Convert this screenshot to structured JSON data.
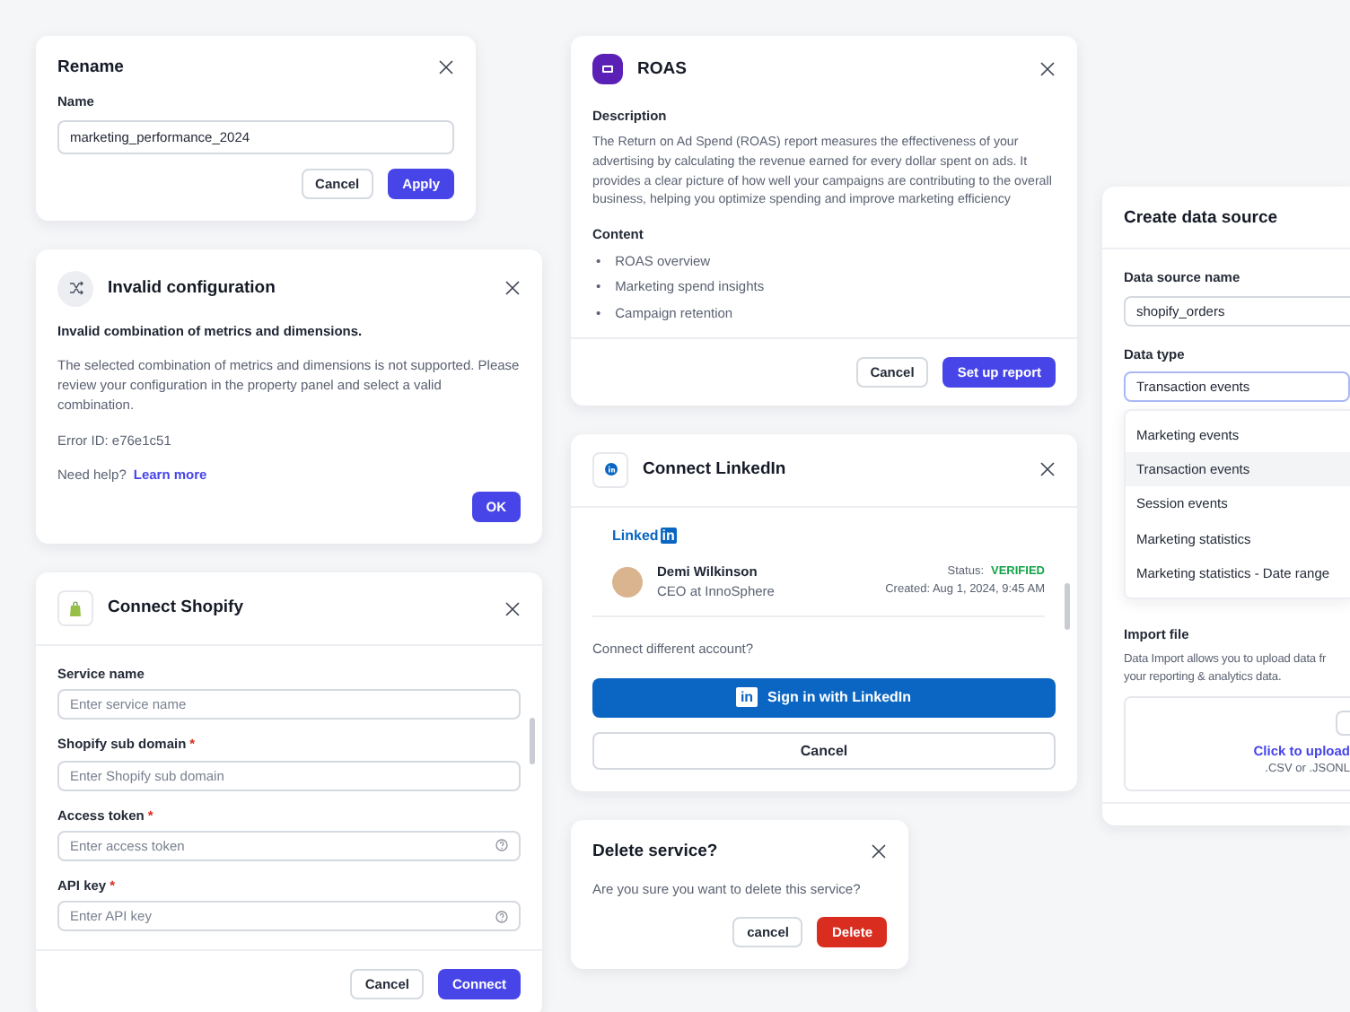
{
  "rename_dialog": {
    "title": "Rename",
    "field_label": "Name",
    "value": "marketing_performance_2024",
    "buttons": [
      {
        "label": "Cancel",
        "kind": "secondary"
      },
      {
        "label": "Apply",
        "kind": "primary"
      }
    ]
  },
  "error_dialog": {
    "title": "Invalid configuration",
    "heading": "Invalid combination of metrics and dimensions.",
    "message": "The selected combination of metrics and dimensions is not supported. Please review your configuration in the property panel and select a valid combination.",
    "error_id": "Error ID: e76e1c51",
    "help_text": "Need help?",
    "help_link": "Learn more",
    "buttons": [
      {
        "label": "OK",
        "kind": "primary"
      }
    ]
  },
  "shopify_dialog": {
    "title": "Connect Shopify",
    "fields": [
      {
        "label": "Service name",
        "placeholder": "Enter service name",
        "help_icon": false
      },
      {
        "label": "Shopify sub domain",
        "required_mark": "*",
        "placeholder": "Enter Shopify sub domain",
        "help_icon": false
      },
      {
        "label": "Access token",
        "required_mark": "*",
        "placeholder": "Enter access token",
        "help_icon": true
      },
      {
        "label": "API key",
        "required_mark": "*",
        "placeholder": "Enter API key",
        "help_icon": true
      }
    ],
    "buttons": [
      {
        "label": "Cancel",
        "kind": "secondary"
      },
      {
        "label": "Connect",
        "kind": "primary"
      }
    ]
  },
  "roas_dialog": {
    "title": "ROAS",
    "description_label": "Description",
    "description": "The Return on Ad Spend (ROAS) report measures the effectiveness of your advertising by calculating the revenue earned for every dollar spent on ads. It provides a clear picture of how well your campaigns are contributing to the overall business, helping you optimize spending and improve marketing efficiency",
    "content_label": "Content",
    "bullet": "•",
    "content_items": [
      "ROAS overview",
      "Marketing spend insights",
      "Campaign retention"
    ],
    "buttons": [
      {
        "label": "Cancel",
        "kind": "secondary"
      },
      {
        "label": "Set up report",
        "kind": "primary"
      }
    ]
  },
  "linkedin_dialog": {
    "title": "Connect LinkedIn",
    "logo_word": "Linked",
    "logo_badge": "in",
    "account": {
      "name": "Demi Wilkinson",
      "role": "CEO at InnoSphere",
      "status_label": "Status:",
      "status": "VERIFIED",
      "created": "Created: Aug 1, 2024, 9:45 AM"
    },
    "prompt": "Connect different account?",
    "buttons": [
      {
        "label": "Sign in with LinkedIn",
        "kind": "linkedin",
        "badge": "in"
      },
      {
        "label": "Cancel",
        "kind": "secondary-wide"
      }
    ]
  },
  "delete_dialog": {
    "title": "Delete service?",
    "message": "Are you sure you want to delete this service?",
    "buttons": [
      {
        "label": "cancel",
        "kind": "secondary"
      },
      {
        "label": "Delete",
        "kind": "danger"
      }
    ]
  },
  "data_source_dialog": {
    "title": "Create data source",
    "name_label": "Data source name",
    "name_value": "shopify_orders",
    "type_label": "Data type",
    "type_value": "Transaction events",
    "options": [
      {
        "label": "Marketing events",
        "selected": false
      },
      {
        "label": "Transaction events",
        "selected": true
      },
      {
        "label": "Session events",
        "selected": false
      },
      {
        "label": "Marketing statistics",
        "selected": false
      },
      {
        "label": "Marketing statistics - Date range",
        "selected": false
      }
    ],
    "import_label": "Import file",
    "import_help": [
      "Data Import allows you to upload data fr",
      "your reporting & analytics data."
    ],
    "upload_link": "Click to upload",
    "upload_hint": ".CSV or .JSONL"
  }
}
